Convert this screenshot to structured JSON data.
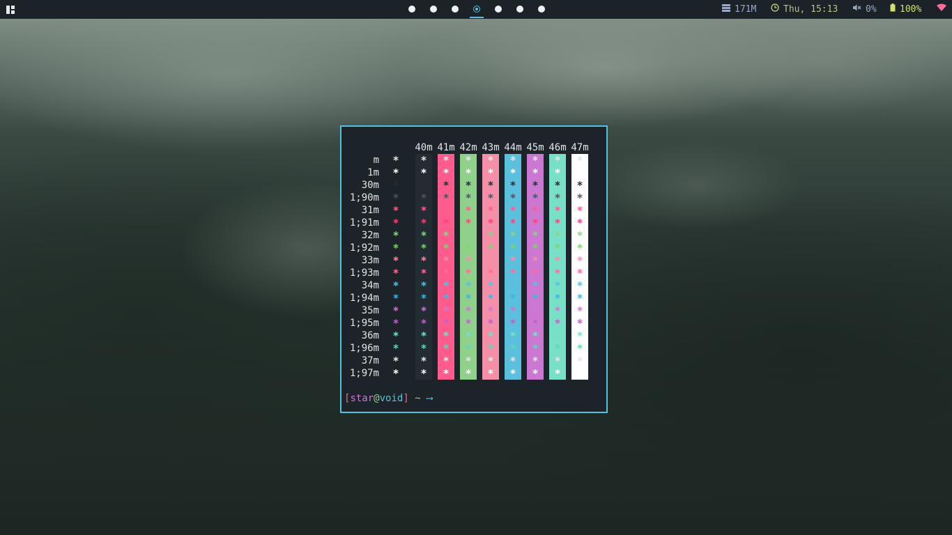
{
  "topbar": {
    "memory": "171M",
    "datetime": "Thu, 15:13",
    "volume": "0%",
    "battery": "100%",
    "workspaces": [
      {
        "active": false
      },
      {
        "active": false
      },
      {
        "active": false
      },
      {
        "active": true
      },
      {
        "active": false
      },
      {
        "active": false
      },
      {
        "active": false
      }
    ],
    "colors": {
      "memory": "#9aa8c4",
      "datetime": "#b6c47e",
      "volume": "#9aa8c4",
      "battery": "#d4e06b",
      "wifi": "#ff6b9a",
      "accent": "#5bc0de"
    }
  },
  "terminal": {
    "columns": [
      "40m",
      "41m",
      "42m",
      "43m",
      "44m",
      "45m",
      "46m",
      "47m"
    ],
    "column_bg": [
      "#242c33",
      "#ff5c8d",
      "#8fd18a",
      "#f58ea8",
      "#5bc0de",
      "#cc78d2",
      "#79e0c8",
      "#ffffff"
    ],
    "rows": [
      {
        "label": "m",
        "fg": "#e6e6e6"
      },
      {
        "label": "1m",
        "fg": "#ffffff"
      },
      {
        "label": "30m",
        "fg": "#242c33"
      },
      {
        "label": "1;90m",
        "fg": "#4a5560"
      },
      {
        "label": "31m",
        "fg": "#ff5c8d"
      },
      {
        "label": "1;91m",
        "fg": "#ff3f7a"
      },
      {
        "label": "32m",
        "fg": "#8fd18a"
      },
      {
        "label": "1;92m",
        "fg": "#7fd46f"
      },
      {
        "label": "33m",
        "fg": "#f58ea8"
      },
      {
        "label": "1;93m",
        "fg": "#ff6b9a"
      },
      {
        "label": "34m",
        "fg": "#5bc0de"
      },
      {
        "label": "1;94m",
        "fg": "#3fb5dc"
      },
      {
        "label": "35m",
        "fg": "#cc78d2"
      },
      {
        "label": "1;95m",
        "fg": "#c060cc"
      },
      {
        "label": "36m",
        "fg": "#79e0c8"
      },
      {
        "label": "1;96m",
        "fg": "#5fd8b8"
      },
      {
        "label": "37m",
        "fg": "#e6e6e6"
      },
      {
        "label": "1;97m",
        "fg": "#ffffff"
      }
    ],
    "star": "*",
    "prompt": {
      "open_bracket": "[",
      "user": "star",
      "at": "@",
      "host": "void",
      "close_bracket": "]",
      "cwd": "~",
      "arrow": "⟶",
      "colors": {
        "bracket": "#ff5c8d",
        "user": "#cc78d2",
        "at": "#8fd18a",
        "host": "#5bc0de",
        "cwd": "#8fd18a",
        "arrow": "#5bc0de"
      }
    }
  }
}
